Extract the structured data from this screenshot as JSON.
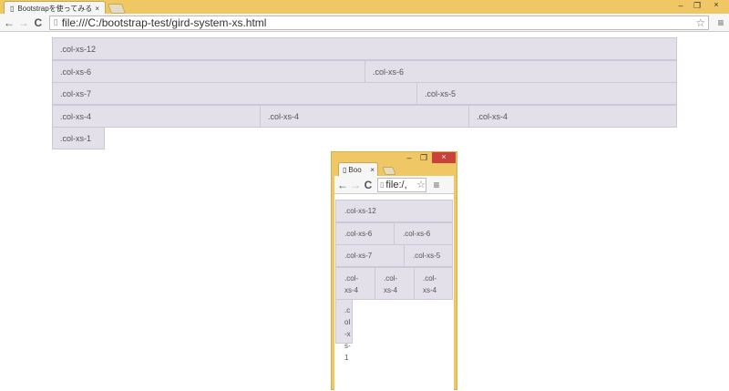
{
  "main": {
    "tab_title": "Bootstrapを使ってみる",
    "url": "file:///C:/bootstrap-test/gird-system-xs.html",
    "rows": [
      [
        ".col-xs-12"
      ],
      [
        ".col-xs-6",
        ".col-xs-6"
      ],
      [
        ".col-xs-7",
        ".col-xs-5"
      ],
      [
        ".col-xs-4",
        ".col-xs-4",
        ".col-xs-4"
      ],
      [
        ".col-xs-1"
      ]
    ]
  },
  "small": {
    "tab_title": "Boo",
    "url": "file:/,",
    "rows": [
      [
        ".col-xs-12"
      ],
      [
        ".col-xs-6",
        ".col-xs-6"
      ],
      [
        ".col-xs-7",
        ".col-xs-5"
      ],
      [
        ".col-xs-4",
        ".col-xs-4",
        ".col-xs-4"
      ],
      [
        ".col-xs-1"
      ]
    ]
  },
  "icons": {
    "close": "×",
    "minimize": "–",
    "maximize": "❐",
    "back": "←",
    "forward": "→",
    "reload": "C",
    "star": "☆",
    "menu": "≡",
    "page": "🗋"
  }
}
